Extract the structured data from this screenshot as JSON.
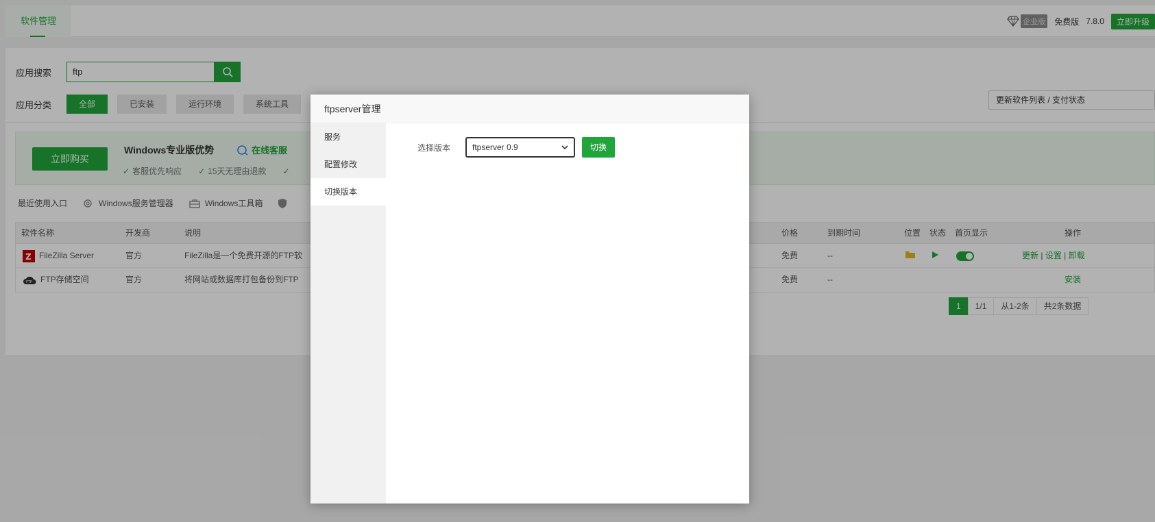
{
  "topbar": {
    "tab_label": "软件管理",
    "enterprise_badge": "企业版",
    "free_edition": "免费版",
    "version": "7.8.0",
    "upgrade_button": "立即升级"
  },
  "search": {
    "label": "应用搜索",
    "value": "ftp"
  },
  "categories": {
    "label": "应用分类",
    "items": [
      "全部",
      "已安装",
      "运行环境",
      "系统工具"
    ]
  },
  "refresh_button": "更新软件列表 / 支付状态",
  "promo": {
    "buy_button": "立即购买",
    "title": "Windows专业版优势",
    "online_cs": "在线客服",
    "features": [
      "客服优先响应",
      "15天无理由退款",
      ""
    ]
  },
  "recent": {
    "label": "最近使用入口",
    "items": [
      "Windows服务管理器",
      "Windows工具箱"
    ]
  },
  "table": {
    "headers": {
      "name": "软件名称",
      "developer": "开发商",
      "desc": "说明",
      "price": "价格",
      "expiry": "到期时间",
      "location": "位置",
      "status": "状态",
      "homepage": "首页显示",
      "ops": "操作"
    },
    "rows": [
      {
        "name": "FileZilla Server",
        "developer": "官方",
        "desc": "FileZilla是一个免费开源的FTP软",
        "price": "免费",
        "expiry": "--",
        "ops": [
          "更新",
          "设置",
          "卸载"
        ]
      },
      {
        "name": "FTP存储空间",
        "developer": "官方",
        "desc": "将网站或数据库打包备份到FTP",
        "price": "免费",
        "expiry": "--",
        "ops": [
          "安装"
        ]
      }
    ]
  },
  "pager": {
    "current": "1",
    "pages": "1/1",
    "range": "从1-2条",
    "total": "共2条数据"
  },
  "modal": {
    "title": "ftpserver管理",
    "side_items": [
      "服务",
      "配置修改",
      "切换版本"
    ],
    "version_label": "选择版本",
    "version_value": "ftpserver 0.9",
    "switch_button": "切换"
  },
  "colors": {
    "accent": "#20a53a"
  }
}
